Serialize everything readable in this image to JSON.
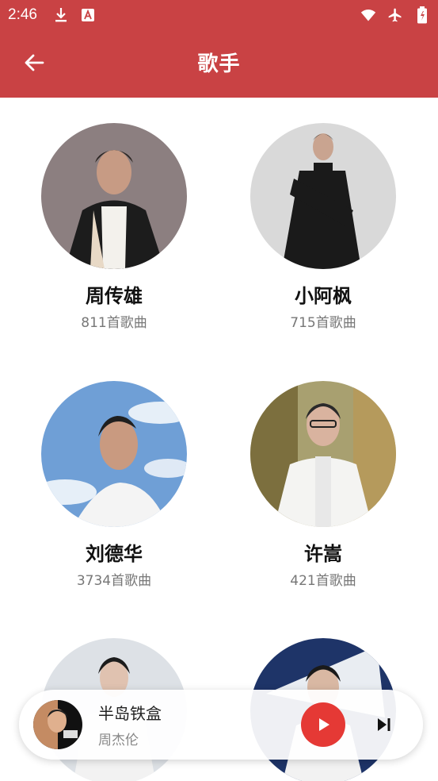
{
  "status_bar": {
    "time": "2:46",
    "icons": [
      "download-icon",
      "a-box-icon",
      "wifi-icon",
      "airplane-icon",
      "battery-icon"
    ]
  },
  "app_bar": {
    "title": "歌手",
    "back_icon": "arrow-left-icon"
  },
  "colors": {
    "primary": "#c94244",
    "play_button": "#e53935"
  },
  "singers": [
    {
      "name": "周传雄",
      "count": "811首歌曲"
    },
    {
      "name": "小阿枫",
      "count": "715首歌曲"
    },
    {
      "name": "刘德华",
      "count": "3734首歌曲"
    },
    {
      "name": "许嵩",
      "count": "421首歌曲"
    },
    {
      "name": "",
      "count": ""
    },
    {
      "name": "",
      "count": ""
    }
  ],
  "player": {
    "song_title": "半岛铁盒",
    "artist": "周杰伦"
  }
}
